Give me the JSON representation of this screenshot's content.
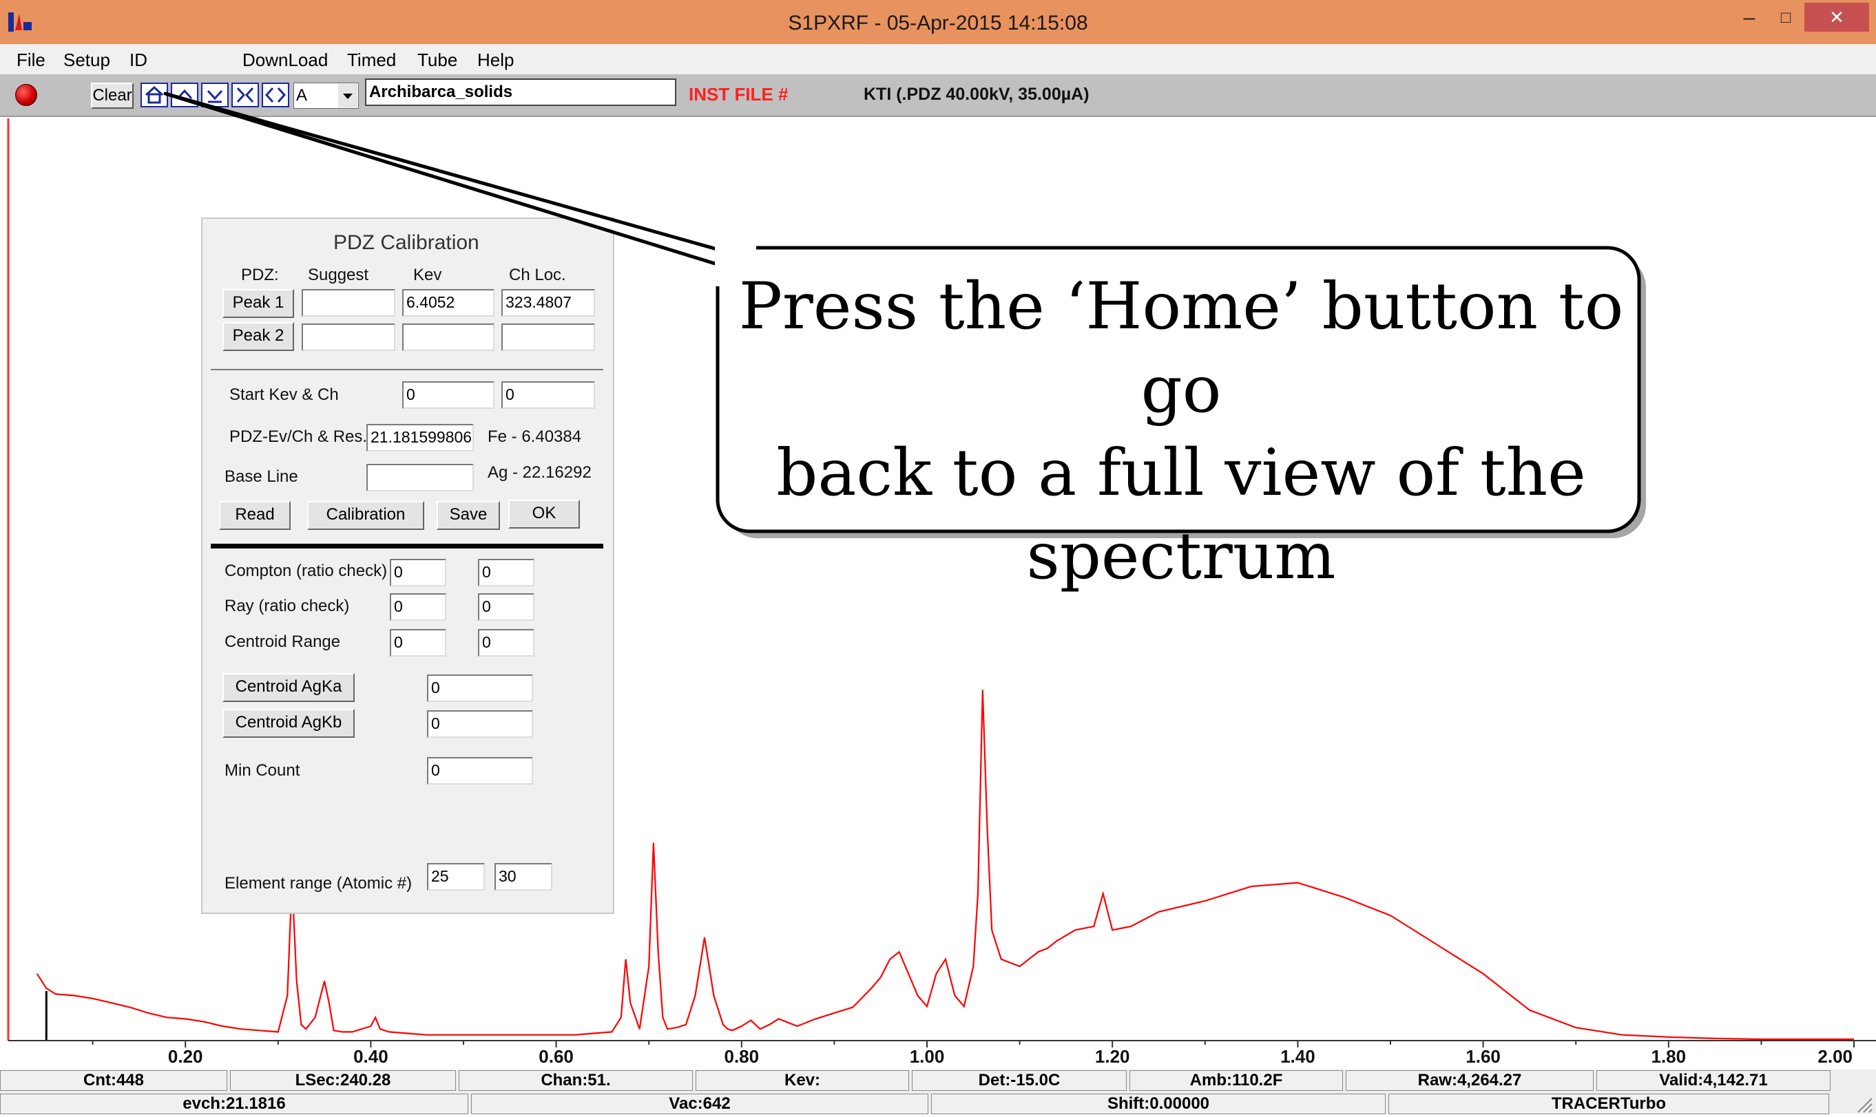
{
  "window": {
    "title": "S1PXRF - 05-Apr-2015 14:15:08",
    "minimize_glyph": "–",
    "maximize_glyph": "□",
    "close_glyph": "✕"
  },
  "menu": [
    "File",
    "Setup",
    "ID",
    "DownLoad",
    "Timed",
    "Tube",
    "Help"
  ],
  "toolbar": {
    "clear_label": "Clear",
    "spectrum_select_value": "A",
    "sample_name": "Archibarca_solids",
    "inst_file_label": "INST FILE #",
    "kti_info": "KTI  (.PDZ 40.00kV, 35.00µA)",
    "buttons": [
      "home-icon",
      "chevron-up-icon",
      "chevron-down-icon",
      "collapse-icon",
      "expand-icon"
    ]
  },
  "calibration_dialog": {
    "title": "PDZ Calibration",
    "headers": {
      "pdz": "PDZ:",
      "suggest": "Suggest",
      "kev": "Kev",
      "ch_loc": "Ch Loc."
    },
    "peak1": {
      "label": "Peak 1",
      "suggest": "",
      "kev": "6.4052",
      "ch_loc": "323.4807"
    },
    "peak2": {
      "label": "Peak 2",
      "suggest": "",
      "kev": "",
      "ch_loc": ""
    },
    "start_kev_label": "Start Kev & Ch",
    "start_kev": "0",
    "start_ch": "0",
    "ev_ch_label": "PDZ-Ev/Ch & Res.",
    "ev_ch_value": "21.1815998062",
    "fe_ref": "Fe - 6.40384",
    "baseline_label": "Base Line",
    "baseline_value": "",
    "ag_ref": "Ag - 22.16292",
    "read_label": "Read",
    "calibration_label": "Calibration",
    "save_label": "Save",
    "ok_label": "OK",
    "compton_label": "Compton (ratio check)",
    "compton": [
      "0",
      "0"
    ],
    "ray_label": "Ray (ratio check)",
    "ray": [
      "0",
      "0"
    ],
    "centroid_range_label": "Centroid Range",
    "centroid_range": [
      "0",
      "0"
    ],
    "centroid_agka_label": "Centroid AgKa",
    "centroid_agka_value": "0",
    "centroid_agkb_label": "Centroid AgKb",
    "centroid_agkb_value": "0",
    "min_count_label": "Min Count",
    "min_count_value": "0",
    "element_range_label": "Element range (Atomic #)",
    "element_range": [
      "25",
      "30"
    ]
  },
  "callout": {
    "lines": [
      "Press the ‘Home’ button to go",
      "back to a full view of the",
      "spectrum"
    ]
  },
  "chart_data": {
    "type": "line",
    "xlabel": "",
    "ylabel": "",
    "x_ticks": [
      "0.20",
      "0.40",
      "0.60",
      "0.80",
      "1.00",
      "1.20",
      "1.40",
      "1.60",
      "1.80",
      "2.00"
    ],
    "xlim": [
      0.0,
      2.0
    ],
    "color": "#ff0000",
    "cursor_x": 0.05,
    "series": [
      {
        "x": [
          0.04,
          0.05,
          0.06,
          0.08,
          0.1,
          0.12,
          0.14,
          0.16,
          0.18,
          0.2,
          0.22,
          0.24,
          0.26,
          0.28,
          0.3,
          0.31,
          0.315,
          0.32,
          0.325,
          0.33,
          0.34,
          0.35,
          0.355,
          0.36,
          0.37,
          0.38,
          0.4,
          0.405,
          0.41,
          0.42,
          0.44,
          0.46,
          0.48,
          0.5,
          0.52,
          0.54,
          0.56,
          0.58,
          0.6,
          0.62,
          0.64,
          0.66,
          0.67,
          0.675,
          0.68,
          0.69,
          0.7,
          0.705,
          0.71,
          0.715,
          0.72,
          0.73,
          0.74,
          0.75,
          0.76,
          0.77,
          0.78,
          0.785,
          0.79,
          0.8,
          0.81,
          0.82,
          0.83,
          0.84,
          0.86,
          0.88,
          0.9,
          0.92,
          0.94,
          0.95,
          0.96,
          0.97,
          0.98,
          0.99,
          1.0,
          1.01,
          1.02,
          1.03,
          1.04,
          1.05,
          1.055,
          1.06,
          1.065,
          1.07,
          1.08,
          1.1,
          1.12,
          1.13,
          1.14,
          1.16,
          1.18,
          1.19,
          1.2,
          1.22,
          1.25,
          1.3,
          1.35,
          1.4,
          1.45,
          1.5,
          1.55,
          1.6,
          1.65,
          1.7,
          1.75,
          1.8,
          1.85,
          1.9,
          1.95,
          2.0
        ],
        "y": [
          90,
          70,
          62,
          60,
          56,
          50,
          44,
          36,
          30,
          28,
          24,
          18,
          14,
          12,
          10,
          60,
          220,
          80,
          20,
          14,
          30,
          80,
          50,
          12,
          10,
          10,
          18,
          30,
          14,
          10,
          8,
          6,
          6,
          6,
          6,
          6,
          6,
          6,
          6,
          6,
          8,
          10,
          30,
          110,
          50,
          14,
          100,
          270,
          120,
          30,
          14,
          16,
          20,
          60,
          140,
          60,
          20,
          14,
          12,
          18,
          26,
          14,
          20,
          28,
          18,
          28,
          36,
          44,
          70,
          85,
          110,
          120,
          90,
          60,
          45,
          90,
          110,
          60,
          45,
          100,
          200,
          480,
          290,
          150,
          110,
          100,
          120,
          125,
          135,
          150,
          155,
          200,
          150,
          155,
          175,
          190,
          210,
          215,
          195,
          170,
          130,
          90,
          40,
          16,
          6,
          3,
          1,
          0,
          0,
          0
        ]
      }
    ],
    "ylim": [
      0,
      520
    ]
  },
  "status_row1": [
    "Cnt:448",
    "LSec:240.28",
    "Chan:51.",
    "Kev:",
    "Det:-15.0C",
    "Amb:110.2F",
    "Raw:4,264.27",
    "Valid:4,142.71"
  ],
  "status_row2": [
    "evch:21.1816",
    "Vac:642",
    "Shift:0.00000",
    "TRACERTurbo"
  ]
}
